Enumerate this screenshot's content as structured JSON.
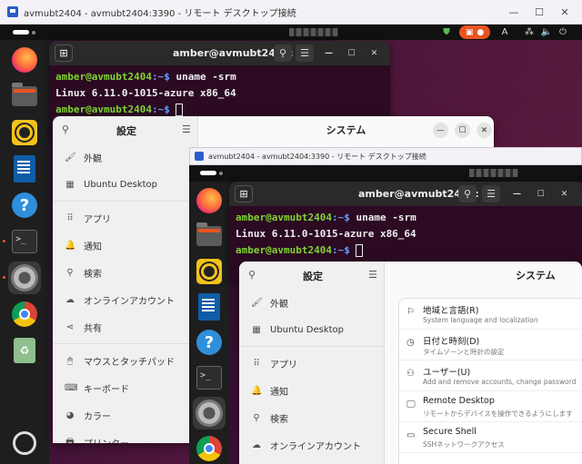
{
  "rdp": {
    "title": "avmubt2404 - avmubt2404:3390 - リモート デスクトップ接続",
    "minimize": "—",
    "maximize": "☐",
    "close": "✕"
  },
  "desktop": {
    "tray_right": [
      "A",
      "⁂",
      "🔈",
      "⏻"
    ]
  },
  "dock": {
    "items": [
      "firefox",
      "files",
      "rhythmbox",
      "libreoffice-writer",
      "help",
      "terminal",
      "settings",
      "chrome",
      "trash",
      "show-apps"
    ]
  },
  "terminal": {
    "title": "amber@avmubt2404: ~",
    "prompt_user": "amber@avmubt2404",
    "prompt_path": ":~$ ",
    "command": "uname -srm",
    "output": "Linux 6.11.0-1015-azure x86_64"
  },
  "settings": {
    "sidebar_title": "設定",
    "main_title": "システム",
    "sidebar_items": [
      {
        "icon": "🖌",
        "label": "外観"
      },
      {
        "icon": "▦",
        "label": "Ubuntu Desktop"
      },
      {
        "icon": "⠿",
        "label": "アプリ"
      },
      {
        "icon": "🔔",
        "label": "通知"
      },
      {
        "icon": "⚲",
        "label": "検索"
      },
      {
        "icon": "☁",
        "label": "オンラインアカウント"
      },
      {
        "icon": "⋖",
        "label": "共有"
      },
      {
        "icon": "🖱",
        "label": "マウスとタッチパッド"
      },
      {
        "icon": "⌨",
        "label": "キーボード"
      },
      {
        "icon": "◕",
        "label": "カラー"
      },
      {
        "icon": "🖶",
        "label": "プリンター"
      }
    ],
    "system_rows": [
      {
        "icon": "⚐",
        "title": "地域と言語(R)",
        "sub": "System language and localization"
      },
      {
        "icon": "◷",
        "title": "日付と時刻(D)",
        "sub": "タイムゾーンと時計の設定"
      },
      {
        "icon": "⚇",
        "title": "ユーザー(U)",
        "sub": "Add and remove accounts, change password"
      },
      {
        "icon": "🖵",
        "title": "Remote Desktop",
        "sub": "リモートからデバイスを操作できるようにします"
      },
      {
        "icon": "▭",
        "title": "Secure Shell",
        "sub": "SSHネットワークアクセス"
      }
    ]
  },
  "inner_rdp": {
    "title": "avmubt2404 - avmubt2404:3390 - リモート デスクトップ接続"
  }
}
